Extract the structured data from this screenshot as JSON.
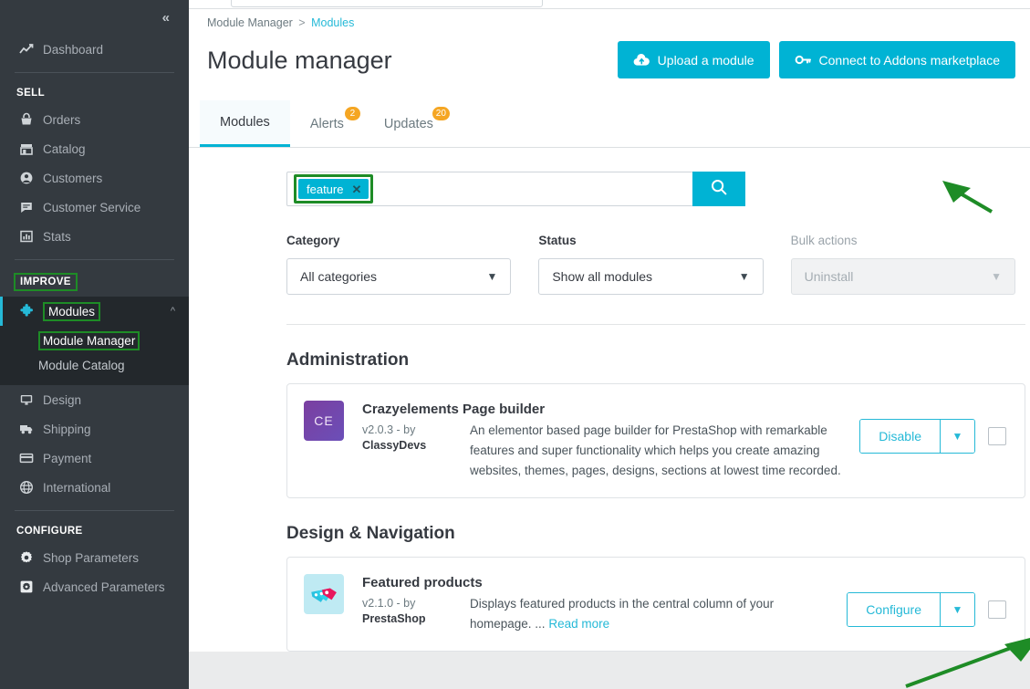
{
  "sidebar": {
    "collapse_icon": "«",
    "dashboard": {
      "label": "Dashboard",
      "icon": "trending-up-icon"
    },
    "sections": [
      {
        "title": "SELL",
        "items": [
          {
            "label": "Orders",
            "icon": "basket-icon"
          },
          {
            "label": "Catalog",
            "icon": "store-icon"
          },
          {
            "label": "Customers",
            "icon": "person-icon"
          },
          {
            "label": "Customer Service",
            "icon": "chat-icon"
          },
          {
            "label": "Stats",
            "icon": "bar-chart-icon"
          }
        ]
      },
      {
        "title": "IMPROVE",
        "items": [
          {
            "label": "Modules",
            "icon": "puzzle-icon",
            "active": true
          },
          {
            "label": "Design",
            "icon": "monitor-icon"
          },
          {
            "label": "Shipping",
            "icon": "truck-icon"
          },
          {
            "label": "Payment",
            "icon": "credit-card-icon"
          },
          {
            "label": "International",
            "icon": "globe-icon"
          }
        ]
      },
      {
        "title": "CONFIGURE",
        "items": [
          {
            "label": "Shop Parameters",
            "icon": "gear-icon"
          },
          {
            "label": "Advanced Parameters",
            "icon": "gear-square-icon"
          }
        ]
      }
    ],
    "submenu": [
      {
        "label": "Module Manager",
        "highlighted": true
      },
      {
        "label": "Module Catalog",
        "highlighted": false
      }
    ]
  },
  "header": {
    "breadcrumb": {
      "parent": "Module Manager",
      "separator": ">",
      "current": "Modules"
    },
    "title": "Module manager",
    "buttons": [
      {
        "label": "Upload a module",
        "icon": "cloud-upload-icon"
      },
      {
        "label": "Connect to Addons marketplace",
        "icon": "key-icon"
      }
    ]
  },
  "tabs": [
    {
      "label": "Modules",
      "badge": "",
      "active": true
    },
    {
      "label": "Alerts",
      "badge": "2",
      "active": false
    },
    {
      "label": "Updates",
      "badge": "20",
      "active": false
    }
  ],
  "search": {
    "tag": "feature",
    "tag_remove_icon": "close-icon",
    "placeholder": "",
    "value": "",
    "button_icon": "search-icon"
  },
  "filters": [
    {
      "label": "Category",
      "value": "All categories",
      "disabled": false,
      "name": "category"
    },
    {
      "label": "Status",
      "value": "Show all modules",
      "disabled": false,
      "name": "status"
    },
    {
      "label": "Bulk actions",
      "value": "Uninstall",
      "disabled": true,
      "name": "bulk-actions"
    }
  ],
  "sections": [
    {
      "title": "Administration",
      "modules": [
        {
          "icon_text": "CE",
          "icon_kind": "ce",
          "name": "Crazyelements Page builder",
          "version": "v2.0.3 - by",
          "author": "ClassyDevs",
          "description": "An elementor based page builder for PrestaShop with remarkable features and super functionality which helps you create amazing websites, themes, pages, designs, sections at lowest time recorded.",
          "read_more": "",
          "action_label": "Disable",
          "caret_icon": "chevron-down-icon"
        }
      ]
    },
    {
      "title": "Design & Navigation",
      "modules": [
        {
          "icon_text": "",
          "icon_kind": "fp",
          "name": "Featured products",
          "version": "v2.1.0 - by",
          "author": "PrestaShop",
          "description": "Displays featured products in the central column of your homepage. ...",
          "read_more": "Read more",
          "action_label": "Configure",
          "caret_icon": "chevron-down-icon"
        }
      ]
    }
  ],
  "annotations": {
    "accent_green": "#1e8c26",
    "arrow_search": "arrow-pointing-to-search-button",
    "arrow_configure": "arrow-pointing-to-configure-button"
  },
  "colors": {
    "teal": "#00b3d4",
    "sidebar_bg": "#343a40",
    "badge_orange": "#f5a623"
  }
}
